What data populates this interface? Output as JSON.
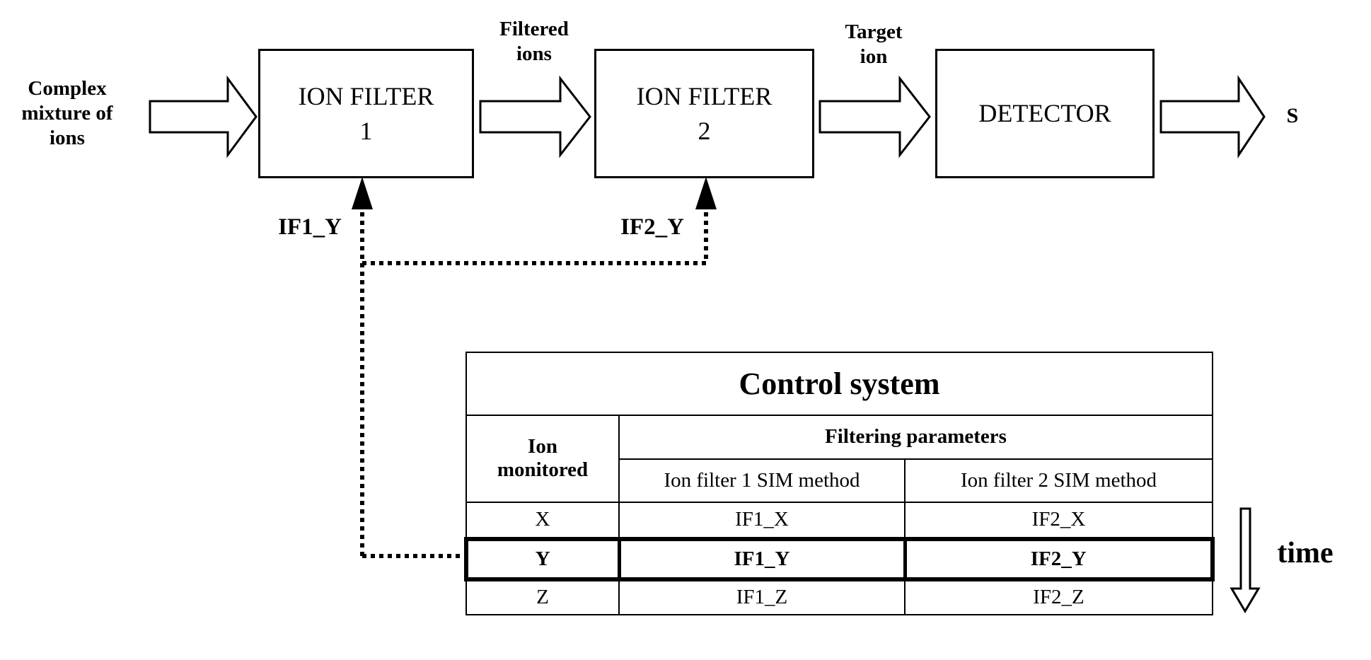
{
  "diagram": {
    "input_label": "Complex mixture of ions",
    "input_label_lines": [
      "Complex",
      "mixture of",
      "ions"
    ],
    "between_1_2_label_lines": [
      "Filtered",
      "ions"
    ],
    "between_2_3_label_lines": [
      "Target",
      "ion"
    ],
    "output_label": "S",
    "blocks": [
      {
        "id": "ion-filter-1",
        "lines": [
          "ION FILTER",
          "1"
        ]
      },
      {
        "id": "ion-filter-2",
        "lines": [
          "ION FILTER",
          "2"
        ]
      },
      {
        "id": "detector",
        "lines": [
          "DETECTOR"
        ]
      }
    ],
    "control_signals": [
      "IF1_Y",
      "IF2_Y"
    ],
    "time_label": "time"
  },
  "control_table": {
    "title": "Control system",
    "col_ion_header_lines": [
      "Ion",
      "monitored"
    ],
    "group_header": "Filtering parameters",
    "sub_headers": [
      "Ion filter 1 SIM method",
      "Ion filter 2 SIM method"
    ],
    "rows": [
      {
        "ion": "X",
        "if1": "IF1_X",
        "if2": "IF2_X",
        "selected": false
      },
      {
        "ion": "Y",
        "if1": "IF1_Y",
        "if2": "IF2_Y",
        "selected": true
      },
      {
        "ion": "Z",
        "if1": "IF1_Z",
        "if2": "IF2_Z",
        "selected": false
      }
    ]
  }
}
